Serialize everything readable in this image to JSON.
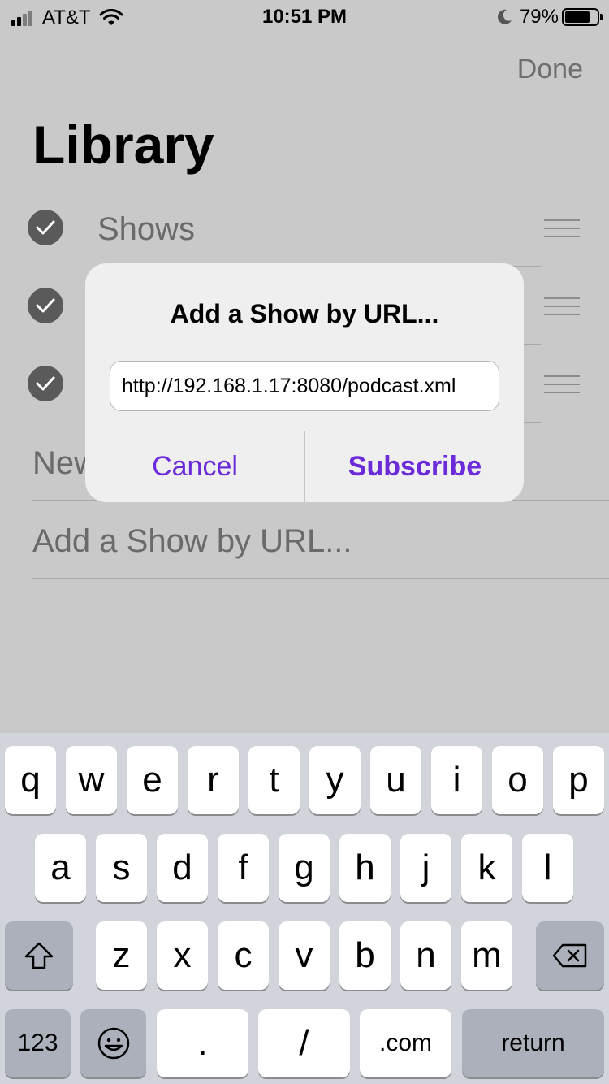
{
  "status_bar": {
    "carrier": "AT&T",
    "time": "10:51 PM",
    "battery": "79%",
    "battery_level": 0.79
  },
  "header": {
    "done_label": "Done",
    "title": "Library"
  },
  "library": {
    "rows": [
      {
        "label": "Shows"
      },
      {
        "label": ""
      },
      {
        "label": ""
      }
    ],
    "new_label": "New",
    "add_show_label": "Add a Show by URL..."
  },
  "alert": {
    "title": "Add a Show by URL...",
    "input_value": "http://192.168.1.17:8080/podcast.xml",
    "cancel_label": "Cancel",
    "subscribe_label": "Subscribe",
    "accent_color": "#6c2bd9"
  },
  "keyboard": {
    "row1": [
      "q",
      "w",
      "e",
      "r",
      "t",
      "y",
      "u",
      "i",
      "o",
      "p"
    ],
    "row2": [
      "a",
      "s",
      "d",
      "f",
      "g",
      "h",
      "j",
      "k",
      "l"
    ],
    "row3": [
      "z",
      "x",
      "c",
      "v",
      "b",
      "n",
      "m"
    ],
    "numbers_label": "123",
    "dot_label": ".",
    "slash_label": "/",
    "dotcom_label": ".com",
    "return_label": "return"
  }
}
